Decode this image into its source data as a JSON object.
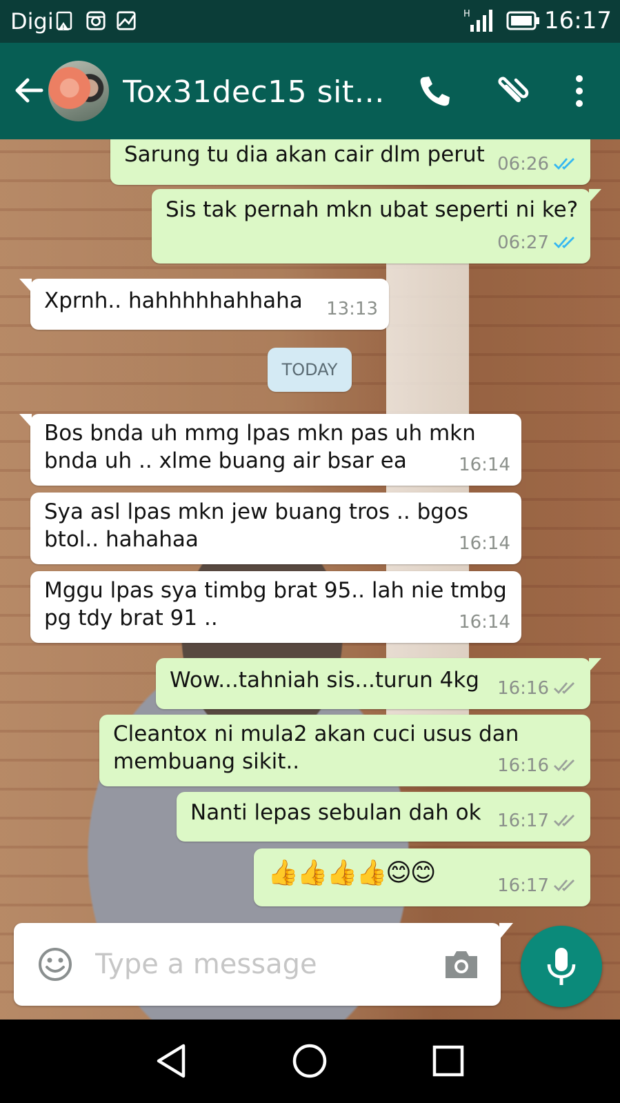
{
  "status_bar": {
    "carrier": "Digi",
    "time": "16:17",
    "network": "H"
  },
  "header": {
    "contact_name": "Tox31dec15 siti n…"
  },
  "messages": [
    {
      "text": "Sarung tu dia akan cair dlm perut",
      "time": "06:26",
      "direction": "out",
      "status": "read"
    },
    {
      "text": "Sis tak pernah mkn ubat seperti ni ke?",
      "time": "06:27",
      "direction": "out",
      "status": "read"
    },
    {
      "text": "Xprnh.. hahhhhhahhaha",
      "time": "13:13",
      "direction": "in"
    },
    {
      "text": "Bos bnda uh mmg lpas mkn pas uh mkn\nbnda uh .. xlme buang air bsar ea",
      "time": "16:14",
      "direction": "in"
    },
    {
      "text": "Sya asl lpas mkn jew buang tros .. bgos\nbtol.. hahahaa",
      "time": "16:14",
      "direction": "in"
    },
    {
      "text": "Mggu lpas sya timbg brat 95.. lah nie tmbg\npg tdy brat 91 ..",
      "time": "16:14",
      "direction": "in"
    },
    {
      "text": "Wow...tahniah sis...turun 4kg",
      "time": "16:16",
      "direction": "out",
      "status": "delivered"
    },
    {
      "text": "Cleantox ni mula2 akan cuci usus dan\nmembuang sikit..",
      "time": "16:16",
      "direction": "out",
      "status": "delivered"
    },
    {
      "text": "Nanti lepas sebulan dah ok",
      "time": "16:17",
      "direction": "out",
      "status": "delivered"
    },
    {
      "text": "👍👍👍👍😊😊",
      "time": "16:17",
      "direction": "out",
      "status": "delivered"
    }
  ],
  "date_divider": "TODAY",
  "composer": {
    "placeholder": "Type a message",
    "value": ""
  },
  "colors": {
    "header": "#075e54",
    "status_bar": "#0b3d38",
    "outgoing_bubble": "#dcf8c6",
    "incoming_bubble": "#ffffff",
    "read_ticks": "#34b7f1",
    "delivered_ticks": "#9aa09a",
    "mic_button": "#0b8a7a"
  },
  "icons": [
    "gallery-lock-icon",
    "instagram-icon",
    "image-icon",
    "signal-icon",
    "battery-icon",
    "back-arrow-icon",
    "phone-icon",
    "paperclip-icon",
    "more-vert-icon",
    "emoji-icon",
    "camera-icon",
    "mic-icon",
    "nav-back-icon",
    "nav-home-icon",
    "nav-recents-icon"
  ]
}
